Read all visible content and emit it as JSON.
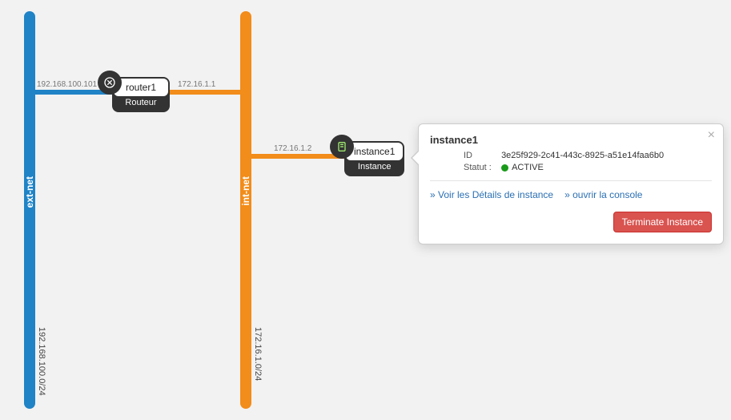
{
  "networks": {
    "ext": {
      "name": "ext-net",
      "cidr": "192.168.100.0/24",
      "color": "#1f83c6"
    },
    "int": {
      "name": "int-net",
      "cidr": "172.16.1.0/24",
      "color": "#f28c1a"
    }
  },
  "nodes": {
    "router": {
      "name": "router1",
      "type_label": "Routeur",
      "ext_ip": "192.168.100.101",
      "int_ip": "172.16.1.1"
    },
    "instance": {
      "name": "instance1",
      "type_label": "Instance",
      "int_ip": "172.16.1.2"
    }
  },
  "popover": {
    "title": "instance1",
    "id_label": "ID",
    "id_value": "3e25f929-2c41-443c-8925-a51e14faa6b0",
    "status_label": "Statut :",
    "status_value": "ACTIVE",
    "link_details": "» Voir les Détails de instance",
    "link_console": "» ouvrir la console",
    "btn_terminate": "Terminate Instance"
  }
}
